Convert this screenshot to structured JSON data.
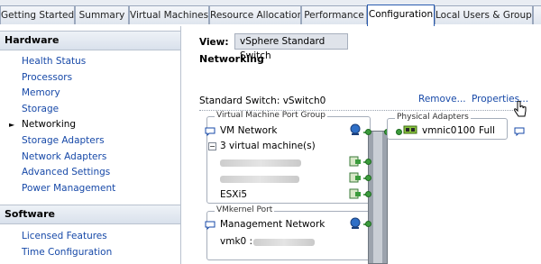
{
  "tabs": [
    {
      "label": "Getting Started"
    },
    {
      "label": "Summary"
    },
    {
      "label": "Virtual Machines"
    },
    {
      "label": "Resource Allocation"
    },
    {
      "label": "Performance"
    },
    {
      "label": "Configuration"
    },
    {
      "label": "Local Users & Groups"
    },
    {
      "label": ""
    }
  ],
  "sidebar": {
    "hardware_header": "Hardware",
    "hardware_items": [
      {
        "label": "Health Status"
      },
      {
        "label": "Processors"
      },
      {
        "label": "Memory"
      },
      {
        "label": "Storage"
      },
      {
        "label": "Networking"
      },
      {
        "label": "Storage Adapters"
      },
      {
        "label": "Network Adapters"
      },
      {
        "label": "Advanced Settings"
      },
      {
        "label": "Power Management"
      }
    ],
    "software_header": "Software",
    "software_items": [
      {
        "label": "Licensed Features"
      },
      {
        "label": "Time Configuration"
      }
    ]
  },
  "main": {
    "view_label": "View:",
    "view_value": "vSphere Standard Switch",
    "section_title": "Networking",
    "switch_label": "Standard Switch: vSwitch0",
    "remove_label": "Remove...",
    "properties_label": "Properties..."
  },
  "diagram": {
    "vm_group_title": "Virtual Machine Port Group",
    "vm_network": "VM Network",
    "vm_count": "3 virtual machine(s)",
    "vm3_name": "ESXi5",
    "vmk_group_title": "VMkernel Port",
    "mgmt_network": "Management Network",
    "vmk_prefix": "vmk0 :",
    "phys_group_title": "Physical Adapters",
    "vmnic": "vmnic0",
    "speed": "100",
    "duplex": "Full"
  },
  "colors": {
    "link": "#1749a8",
    "accent": "#2b5cb0",
    "node_green": "#3b9b3c"
  },
  "icons": [
    "speech-bubble-icon",
    "network-port-icon",
    "vm-icon",
    "nic-icon",
    "hand-cursor-icon",
    "bullet-icon"
  ]
}
